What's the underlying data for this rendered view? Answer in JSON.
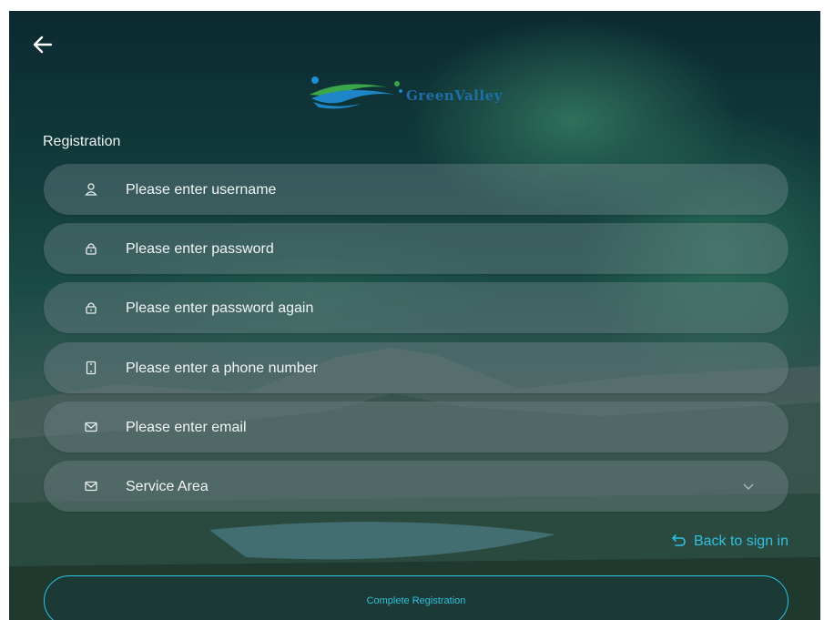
{
  "app": {
    "brand_name": "GreenValley"
  },
  "header": {
    "back_icon": "arrow-left-icon"
  },
  "form": {
    "title": "Registration",
    "fields": [
      {
        "icon": "user-icon",
        "placeholder": "Please enter username",
        "value": ""
      },
      {
        "icon": "lock-icon",
        "placeholder": "Please enter password",
        "value": ""
      },
      {
        "icon": "lock-icon",
        "placeholder": "Please enter password again",
        "value": ""
      },
      {
        "icon": "phone-icon",
        "placeholder": "Please enter a phone number",
        "value": ""
      },
      {
        "icon": "mail-icon",
        "placeholder": "Please enter email",
        "value": ""
      },
      {
        "icon": "mail-icon",
        "placeholder": "Service Area",
        "value": "",
        "dropdown_icon": "chevron-down-icon"
      }
    ],
    "back_to_signin": {
      "icon": "return-icon",
      "label": "Back to sign in"
    },
    "submit_label": "Complete Registration"
  },
  "colors": {
    "accent": "#2fc0e0",
    "logo_blue": "#1e6fa8",
    "logo_green": "#3aa54a"
  }
}
